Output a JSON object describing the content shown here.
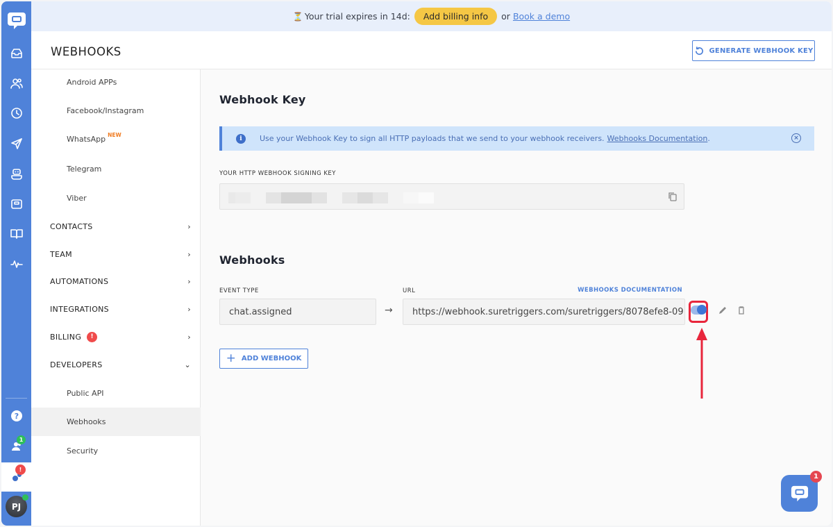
{
  "banner": {
    "hourglass": "⏳",
    "trial_text": "Your trial expires in 14d:",
    "billing_button": "Add billing info",
    "or": "or",
    "demo_link": "Book a demo"
  },
  "header": {
    "title": "WEBHOOKS",
    "generate_button": "GENERATE WEBHOOK KEY"
  },
  "rail": {
    "items": [
      "chat-logo",
      "inbox",
      "contacts",
      "history",
      "send",
      "bot",
      "inbox-card",
      "knowledge-book",
      "activity"
    ],
    "team_badge": "1",
    "settings_badge": "!",
    "avatar_initials": "PJ",
    "colors": {
      "rail": "#4f82d9",
      "online": "#2fbf5b",
      "alert": "#f04b4b"
    }
  },
  "nav": {
    "sub_top": [
      {
        "label": "Android APPs"
      },
      {
        "label": "Facebook/Instagram"
      },
      {
        "label": "WhatsApp",
        "tag": "NEW"
      },
      {
        "label": "Telegram"
      },
      {
        "label": "Viber"
      }
    ],
    "sections": [
      {
        "label": "CONTACTS",
        "chevron": "›"
      },
      {
        "label": "TEAM",
        "chevron": "›"
      },
      {
        "label": "AUTOMATIONS",
        "chevron": "›"
      },
      {
        "label": "INTEGRATIONS",
        "chevron": "›"
      },
      {
        "label": "BILLING",
        "chevron": "›",
        "badge": "!"
      },
      {
        "label": "DEVELOPERS",
        "chevron": "⌄"
      }
    ],
    "developer_items": [
      {
        "label": "Public API"
      },
      {
        "label": "Webhooks",
        "active": true
      },
      {
        "label": "Security"
      }
    ]
  },
  "main": {
    "key_section_title": "Webhook Key",
    "info_text": "Use your Webhook Key to sign all HTTP payloads that we send to your webhook receivers.",
    "info_link": "Webhooks Documentation",
    "info_period": ".",
    "info_close": "×",
    "key_label": "YOUR HTTP WEBHOOK SIGNING KEY",
    "webhooks_title": "Webhooks",
    "event_type_label": "EVENT TYPE",
    "url_label": "URL",
    "docs_link": "WEBHOOKS DOCUMENTATION",
    "webhooks": [
      {
        "event_type": "chat.assigned",
        "url": "https://webhook.suretriggers.com/suretriggers/8078efe8-09",
        "enabled": true
      }
    ],
    "arrow": "→",
    "add_button": "ADD WEBHOOK",
    "add_icon": "+"
  },
  "chat_widget": {
    "badge": "1"
  }
}
